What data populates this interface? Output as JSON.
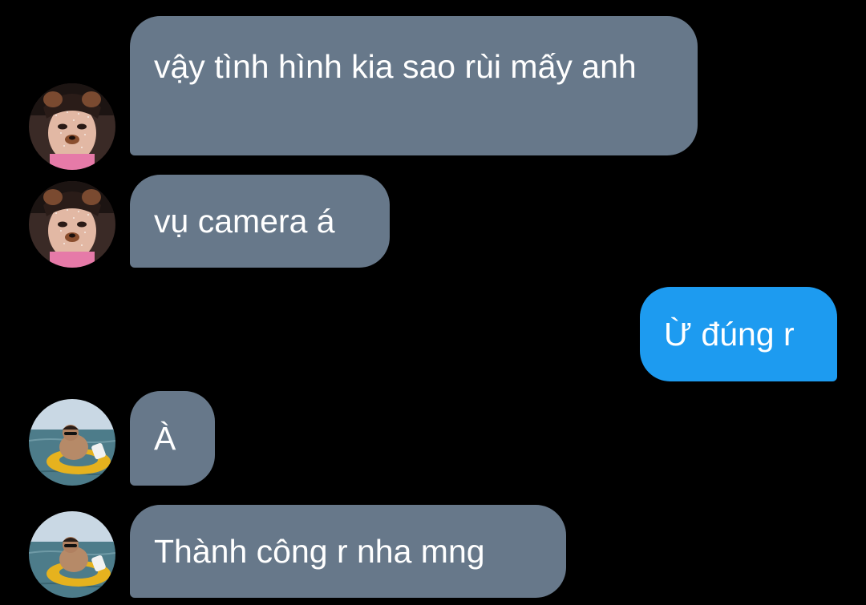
{
  "colors": {
    "background": "#000000",
    "incoming_bubble": "#67788a",
    "outgoing_bubble": "#1d9bf0",
    "text": "#ffffff"
  },
  "conversation": {
    "messages": [
      {
        "direction": "incoming",
        "sender_avatar": "avatar-dog-filter-selfie",
        "text": "vậy tình hình kia sao rùi mấy anh"
      },
      {
        "direction": "incoming",
        "sender_avatar": "avatar-dog-filter-selfie",
        "text": "vụ camera á"
      },
      {
        "direction": "outgoing",
        "text": "Ừ đúng r"
      },
      {
        "direction": "incoming",
        "sender_avatar": "avatar-swim-ring-sea",
        "text": "À"
      },
      {
        "direction": "incoming",
        "sender_avatar": "avatar-swim-ring-sea",
        "text": "Thành công r nha mng"
      }
    ]
  }
}
